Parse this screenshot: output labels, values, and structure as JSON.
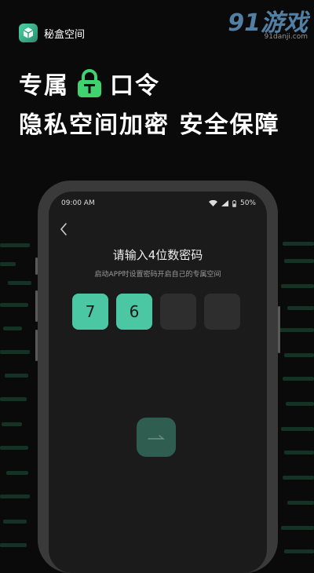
{
  "app": {
    "name": "秘盒空间"
  },
  "watermark": {
    "mark": "91游戏",
    "site": "91danji.com"
  },
  "headline": {
    "part1": "专属",
    "part2": "口令",
    "line2": "隐私空间加密 安全保障"
  },
  "status_bar": {
    "time": "09:00 AM",
    "battery": "50%"
  },
  "passcode": {
    "title": "请输入4位数密码",
    "subtitle": "启动APP时设置密码开启自己的专属空间",
    "digits": [
      "7",
      "6",
      "",
      ""
    ]
  },
  "colors": {
    "accent": "#4bc7a3",
    "lock": "#3fd26e",
    "submit": "#2f5d4f"
  },
  "icons": {
    "back": "back-arrow-icon",
    "submit": "arrow-right-icon",
    "lock": "lock-icon"
  }
}
